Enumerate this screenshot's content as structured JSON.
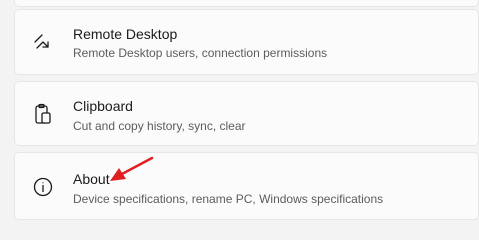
{
  "settings_list": {
    "items": [
      {
        "icon": "remote-desktop-icon",
        "title": "Remote Desktop",
        "description": "Remote Desktop users, connection permissions"
      },
      {
        "icon": "clipboard-icon",
        "title": "Clipboard",
        "description": "Cut and copy history, sync, clear"
      },
      {
        "icon": "info-icon",
        "title": "About",
        "description": "Device specifications, rename PC, Windows specifications"
      }
    ]
  },
  "annotation": {
    "icon": "red-arrow-icon",
    "color": "#e02020"
  },
  "colors": {
    "background": "#f3f3f3",
    "card": "#fbfbfb",
    "title_text": "#1b1b1b",
    "description_text": "#5c5c5c"
  }
}
